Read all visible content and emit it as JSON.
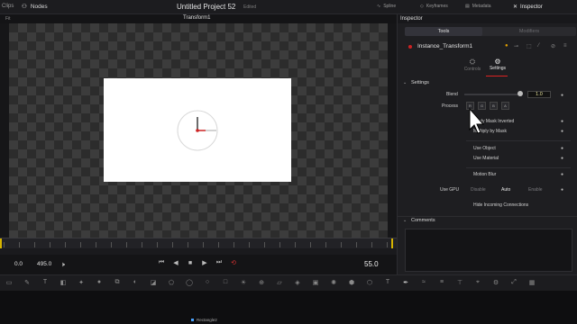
{
  "topbar": {
    "clips_label": "Clips",
    "nodes_label": "Nodes",
    "project_title": "Untitled Project 52",
    "edited_label": "Edited",
    "right_tabs": [
      {
        "label": "Spline"
      },
      {
        "label": "Keyframes"
      },
      {
        "label": "Metadata"
      },
      {
        "label": "Inspector"
      }
    ]
  },
  "viewer": {
    "fit_label": "Fit",
    "title": "Transform1"
  },
  "transport": {
    "current_time": "0.0",
    "end_field": "495.0",
    "end_time": "55.0"
  },
  "inspector": {
    "header": "Inspector",
    "tab_tools": "Tools",
    "tab_modifiers": "Modifiers",
    "tool_name": "Instance_Transform1",
    "sub_tabs": {
      "controls": "Controls",
      "settings": "Settings"
    },
    "section_settings": "Settings",
    "blend_label": "Blend",
    "blend_value": "1.0",
    "blend_level": 1.0,
    "process_label": "Process",
    "process_channels": [
      "R",
      "G",
      "B",
      "A"
    ],
    "options": {
      "apply_mask_inverted": "Apply Mask Inverted",
      "multiply_by_mask": "Multiply by Mask",
      "use_object": "Use Object",
      "use_material": "Use Material",
      "motion_blur": "Motion Blur"
    },
    "use_gpu_label": "Use GPU",
    "use_gpu_options": [
      "Disable",
      "Auto",
      "Enable"
    ],
    "use_gpu_selected": "Auto",
    "hide_incoming": "Hide Incoming Connections",
    "section_comments": "Comments"
  },
  "nodes": {
    "node_label": "Rectangle2"
  },
  "colors": {
    "accent_red": "#d22222",
    "highlight_orange": "#e2a000",
    "value_yellow": "#e7e49a",
    "playhead_yellow": "#d6b400"
  }
}
